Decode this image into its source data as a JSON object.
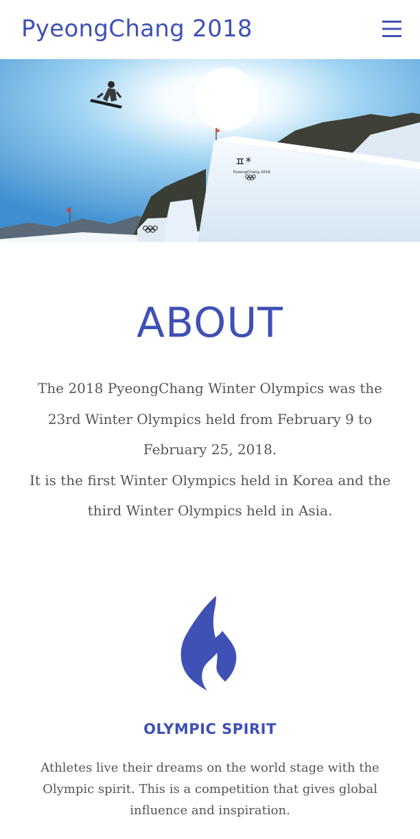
{
  "header": {
    "brand": "PyeongChang 2018",
    "menu_icon": "hamburger-menu-icon"
  },
  "hero": {
    "logo_text": "PyeongChang 2018"
  },
  "about": {
    "title": "ABOUT",
    "paragraph_1": "The 2018 PyeongChang Winter Olympics was the 23rd Winter Olympics held from February 9 to February 25, 2018.",
    "paragraph_2": "It is the first Winter Olympics held in Korea and the third Winter Olympics held in Asia."
  },
  "spirit": {
    "icon": "flame-icon",
    "title": "OLYMPIC SPIRIT",
    "text": "Athletes live their dreams on the world stage with the Olympic spirit. This is a competition that gives global influence and inspiration."
  },
  "colors": {
    "accent": "#3f51b5",
    "body_text": "#555555",
    "background": "#ffffff"
  }
}
